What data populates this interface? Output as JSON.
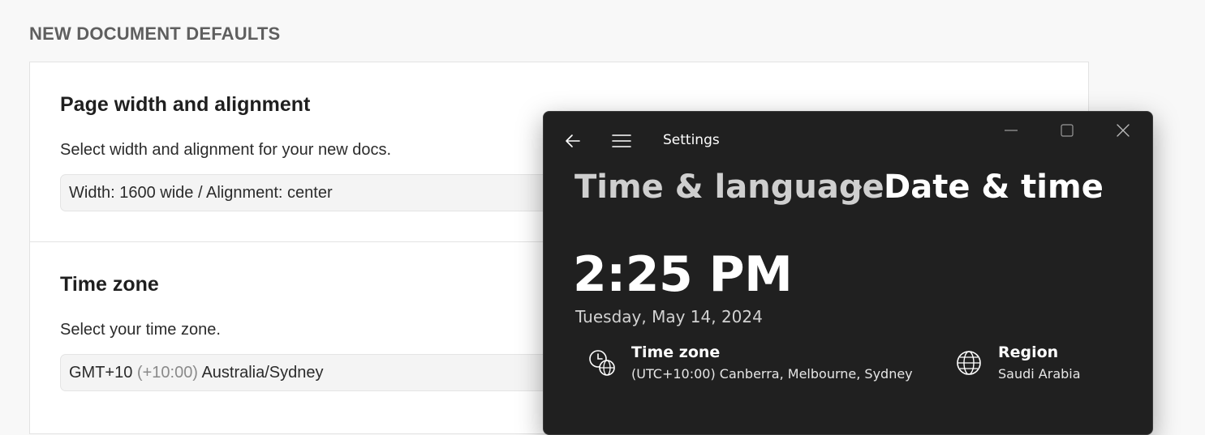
{
  "doc_settings": {
    "section_heading": "NEW DOCUMENT DEFAULTS",
    "page_width": {
      "title": "Page width and alignment",
      "description": "Select width and alignment for your new docs.",
      "value": "Width: 1600 wide / Alignment: center"
    },
    "time_zone": {
      "title": "Time zone",
      "description": "Select your time zone.",
      "value_prefix": "GMT+10",
      "value_offset": "(+10:00)",
      "value_city": "Australia/Sydney"
    }
  },
  "settings_window": {
    "app_title": "Settings",
    "breadcrumb": {
      "parent": "Time & language",
      "separator": "›",
      "current": "Date & time"
    },
    "time": "2:25 PM",
    "date": "Tuesday, May 14, 2024",
    "time_zone": {
      "label": "Time zone",
      "value": "(UTC+10:00) Canberra, Melbourne, Sydney",
      "icon": "clock-globe-icon"
    },
    "region": {
      "label": "Region",
      "value": "Saudi Arabia",
      "icon": "globe-icon"
    },
    "icons": {
      "back": "back-arrow-icon",
      "menu": "hamburger-menu-icon",
      "minimize": "minimize-icon",
      "maximize": "maximize-icon",
      "close": "close-icon"
    },
    "colors": {
      "background": "#202020",
      "text": "#ffffff",
      "breadcrumb_parent": "#cfcfcf"
    }
  }
}
